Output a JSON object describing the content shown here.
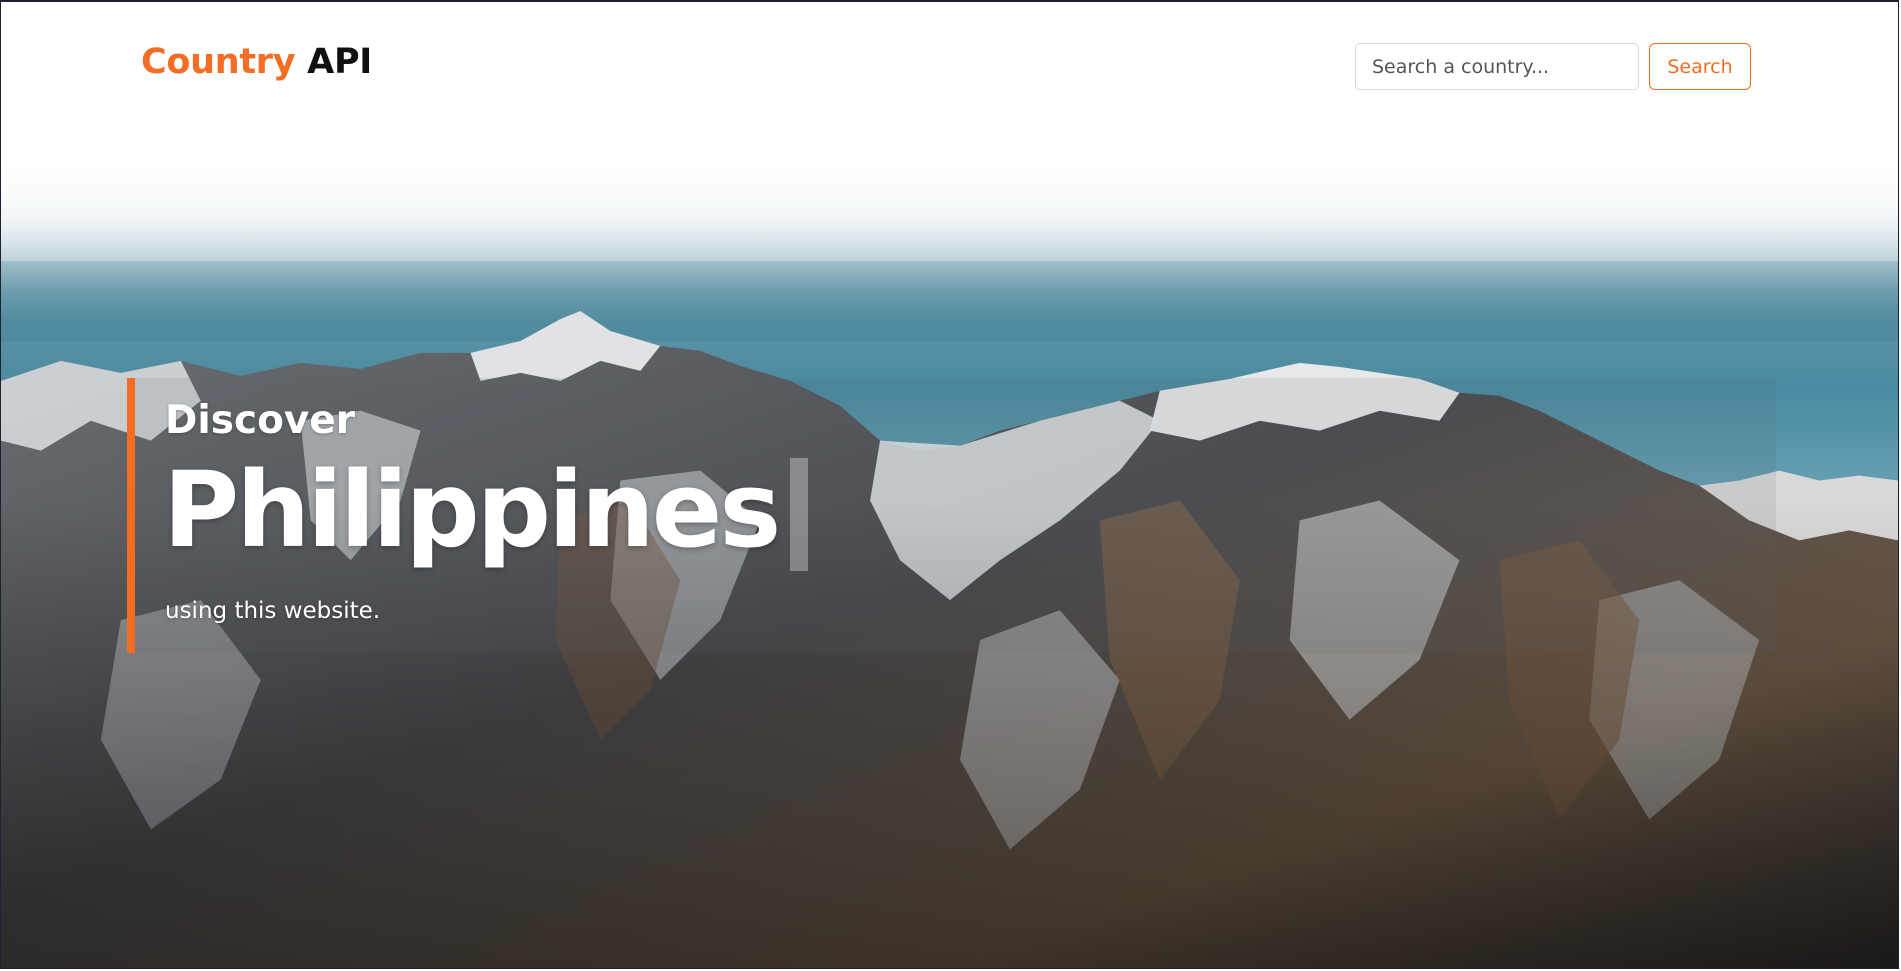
{
  "header": {
    "brand_part1": "Country",
    "brand_part2": "API",
    "search_placeholder": "Search a country...",
    "search_value": "",
    "search_button_label": "Search"
  },
  "hero": {
    "eyebrow": "Discover",
    "country": "Philippines",
    "subtitle": "using this website.",
    "background": "snowy-mountain-range-photo"
  },
  "colors": {
    "accent": "#f46d25",
    "brand_dark": "#111111",
    "hero_text": "#ffffff"
  }
}
